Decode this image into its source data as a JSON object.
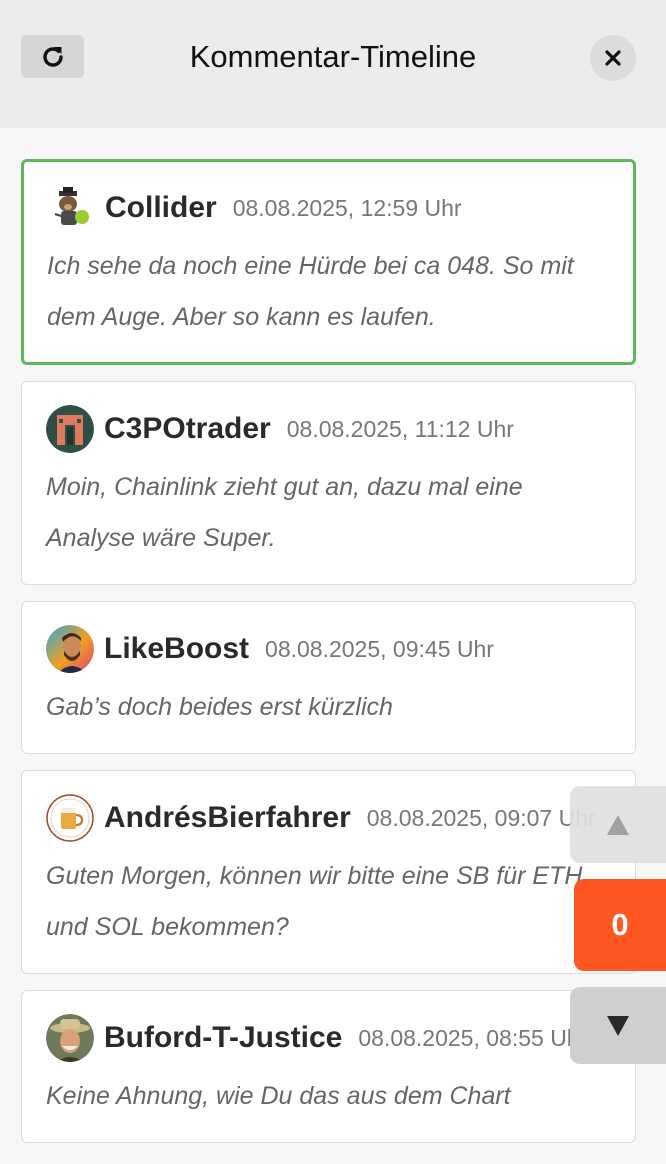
{
  "header": {
    "title": "Kommentar-Timeline",
    "refresh_icon": "refresh-icon",
    "close_icon": "close-icon"
  },
  "comments": [
    {
      "username": "Collider",
      "timestamp": "08.08.2025, 12:59 Uhr",
      "text": "Ich sehe da noch eine Hürde bei ca 048. So mit dem Auge. Aber so kann es laufen.",
      "highlighted": true,
      "avatar_icon": "bear-avatar"
    },
    {
      "username": "C3POtrader",
      "timestamp": "08.08.2025, 11:12 Uhr",
      "text": "Moin, Chainlink zieht gut an, dazu mal eine Analyse wäre Super.",
      "highlighted": false,
      "avatar_icon": "robot-avatar"
    },
    {
      "username": "LikeBoost",
      "timestamp": "08.08.2025, 09:45 Uhr",
      "text": "Gab’s doch beides erst kürzlich",
      "highlighted": false,
      "avatar_icon": "person-avatar"
    },
    {
      "username": "AndrésBierfahrer",
      "timestamp": "08.08.2025, 09:07 Uhr",
      "text": "Guten Morgen, können wir bitte eine SB für ETH und SOL bekommen?",
      "highlighted": false,
      "avatar_icon": "beer-mug-avatar"
    },
    {
      "username": "Buford-T-Justice",
      "timestamp": "08.08.2025, 08:55 Uhr",
      "text": "Keine Ahnung, wie Du das aus dem Chart",
      "highlighted": false,
      "avatar_icon": "cowboy-avatar"
    }
  ],
  "floating_controls": {
    "up_icon": "triangle-up-icon",
    "counter": "0",
    "down_icon": "triangle-down-icon"
  },
  "colors": {
    "highlight_border": "#5cb85c",
    "counter_bg": "#ff5722"
  }
}
